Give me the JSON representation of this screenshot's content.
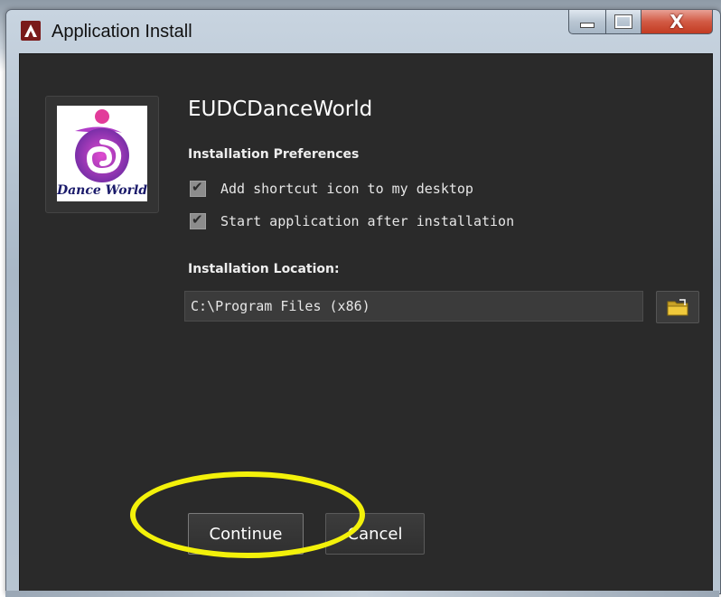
{
  "window": {
    "title": "Application Install",
    "minimize_label": "",
    "maximize_label": "",
    "close_label": "X"
  },
  "app": {
    "name": "EUDCDanceWorld",
    "logo_text": "Dance World"
  },
  "preferences": {
    "heading": "Installation Preferences",
    "options": [
      {
        "label": "Add shortcut icon to my desktop",
        "checked": true
      },
      {
        "label": "Start application after installation",
        "checked": true
      }
    ]
  },
  "location": {
    "heading": "Installation Location:",
    "value": "C:\\Program Files (x86)",
    "browse_icon": "folder-icon"
  },
  "actions": {
    "continue_label": "Continue",
    "cancel_label": "Cancel"
  },
  "annotation": {
    "highlight_color": "#f3f10a",
    "target": "continue-button"
  },
  "colors": {
    "client_bg": "#2a2a2a",
    "close_button": "#c23b22",
    "app_icon": "#7a1a1a"
  }
}
